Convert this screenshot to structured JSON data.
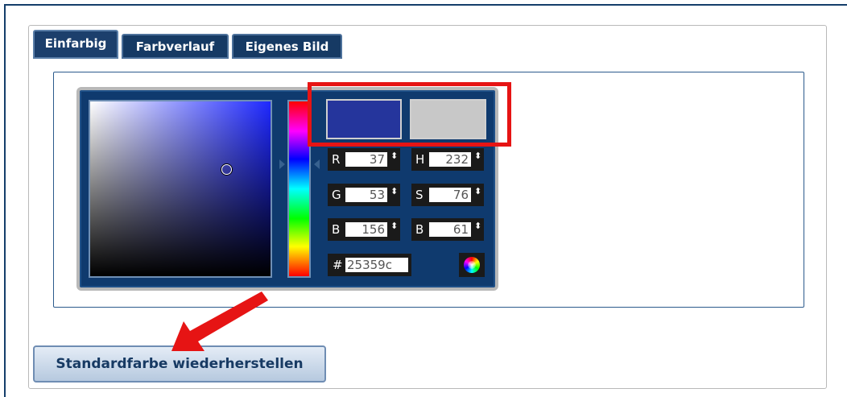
{
  "tabs": [
    {
      "label": "Einfarbig",
      "active": true
    },
    {
      "label": "Farbverlauf",
      "active": false
    },
    {
      "label": "Eigenes Bild",
      "active": false
    }
  ],
  "picker": {
    "current_color": "#25359c",
    "previous_color": "#c8c8c8",
    "rgb": {
      "r_label": "R",
      "r_value": "37",
      "g_label": "G",
      "g_value": "53",
      "b_label": "B",
      "b_value": "156"
    },
    "hsb": {
      "h_label": "H",
      "h_value": "232",
      "s_label": "S",
      "s_value": "76",
      "b_label": "B",
      "b_value": "61"
    },
    "hex_label": "#",
    "hex_value": "25359c",
    "spin_symbol": "⬍"
  },
  "buttons": {
    "reset_label": "Standardfarbe wiederherstellen"
  },
  "annotations": {
    "highlight_color": "#e61414",
    "arrow_color": "#e61414"
  }
}
